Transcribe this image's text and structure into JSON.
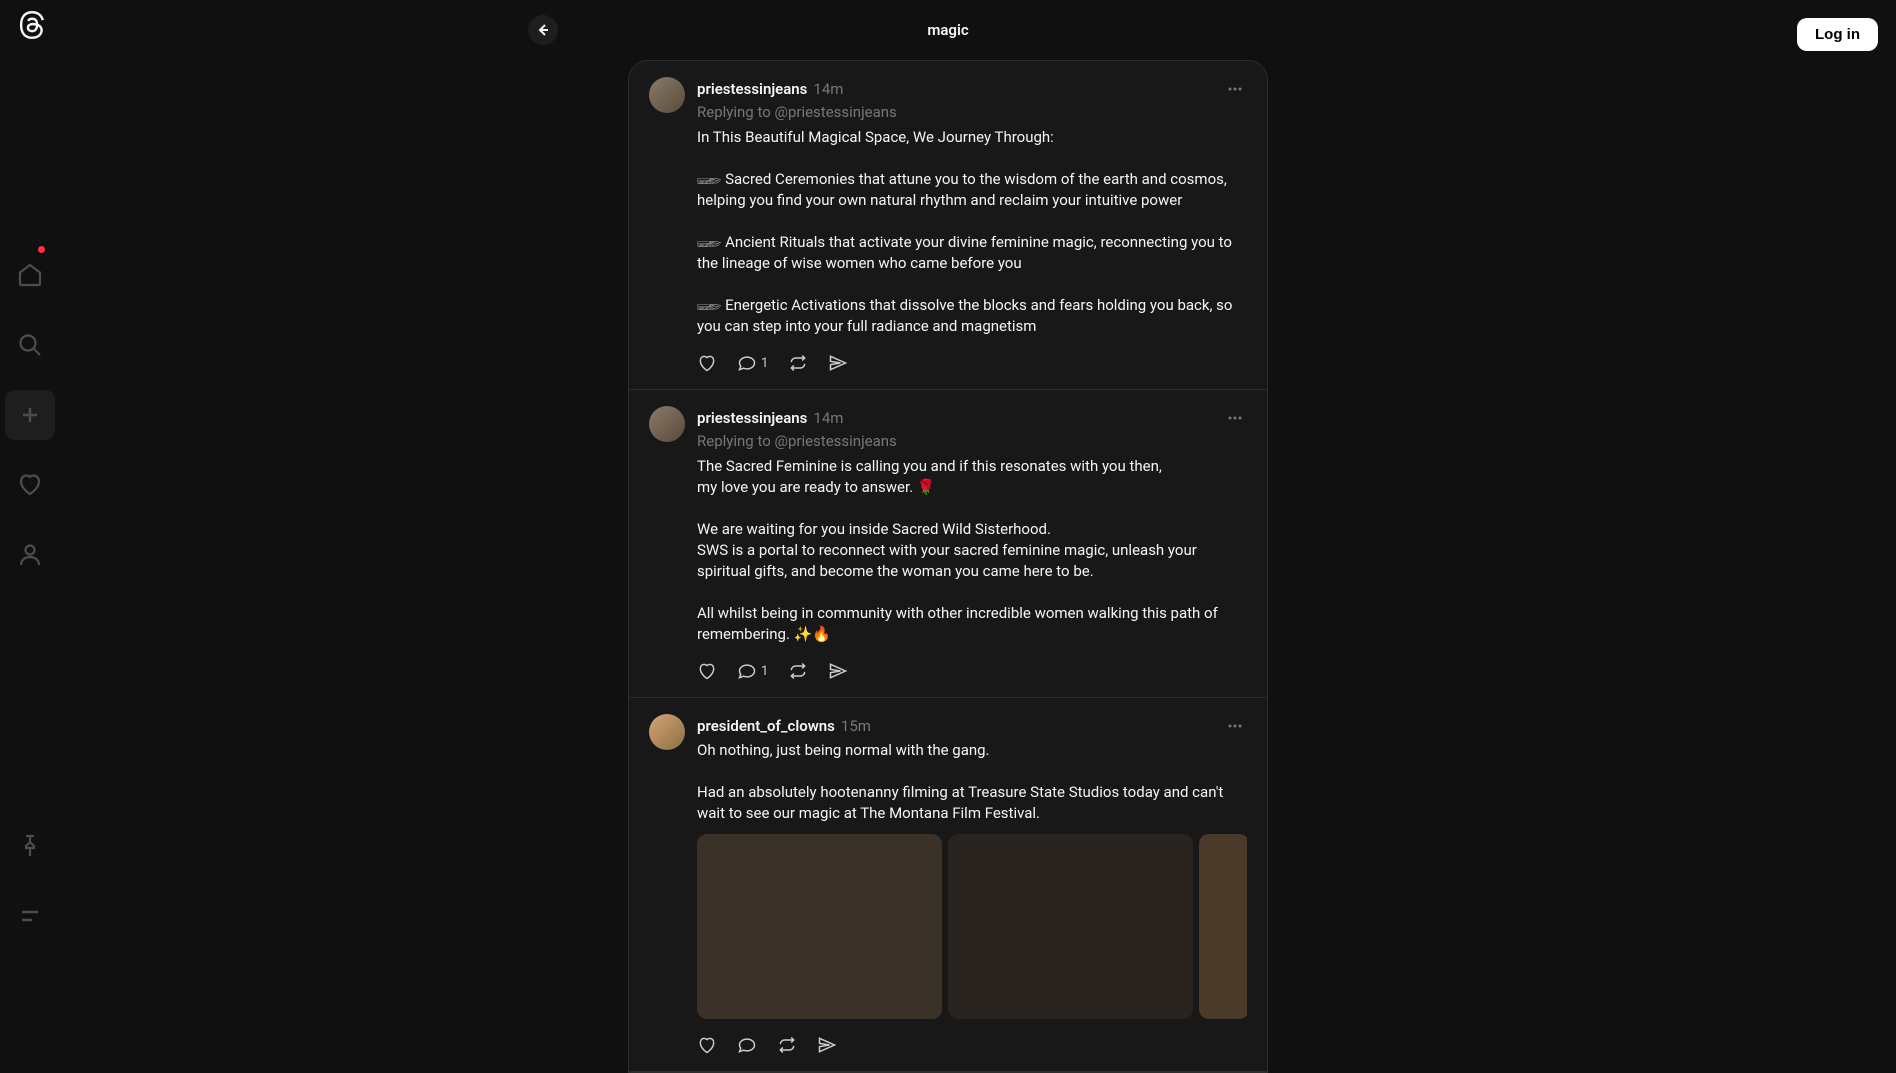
{
  "header": {
    "title": "magic",
    "login_label": "Log in"
  },
  "sidebar": {
    "items": [
      {
        "name": "home",
        "active": false,
        "has_indicator": true
      },
      {
        "name": "search",
        "active": false
      },
      {
        "name": "create",
        "active": false
      },
      {
        "name": "activity",
        "active": false
      },
      {
        "name": "profile",
        "active": false
      }
    ]
  },
  "posts": [
    {
      "username": "priestessinjeans",
      "timestamp": "14m",
      "replying_to": "Replying to @priestessinjeans",
      "body": "In This Beautiful Magical Space, We Journey Through:\n\n𓆃 Sacred Ceremonies that attune you to the wisdom of the earth and cosmos, helping you find your own natural rhythm and reclaim your intuitive power\n\n𓆃 Ancient Rituals that activate your divine feminine magic, reconnecting you to the lineage of wise women who came before you\n\n𓆃 Energetic Activations that dissolve the blocks and fears holding you back, so you can step into your full radiance and magnetism",
      "reply_count": "1",
      "avatar_class": ""
    },
    {
      "username": "priestessinjeans",
      "timestamp": "14m",
      "replying_to": "Replying to @priestessinjeans",
      "body": "The Sacred Feminine is calling you and if this resonates with you then,\nmy love you are ready to answer. 🌹\n\nWe are waiting for you inside Sacred Wild Sisterhood.\nSWS is a portal to reconnect with your sacred feminine magic, unleash your spiritual gifts, and become the woman you came here to be.\n\nAll whilst being in community with other incredible women walking this path of remembering. ✨🔥",
      "reply_count": "1",
      "avatar_class": ""
    },
    {
      "username": "president_of_clowns",
      "timestamp": "15m",
      "replying_to": "",
      "body": "Oh nothing, just being normal with the gang.\n\nHad an absolutely hootenanny filming at Treasure State Studios today and can't wait to see our magic at The Montana Film Festival.",
      "reply_count": "",
      "avatar_class": "clown",
      "has_images": true
    }
  ]
}
